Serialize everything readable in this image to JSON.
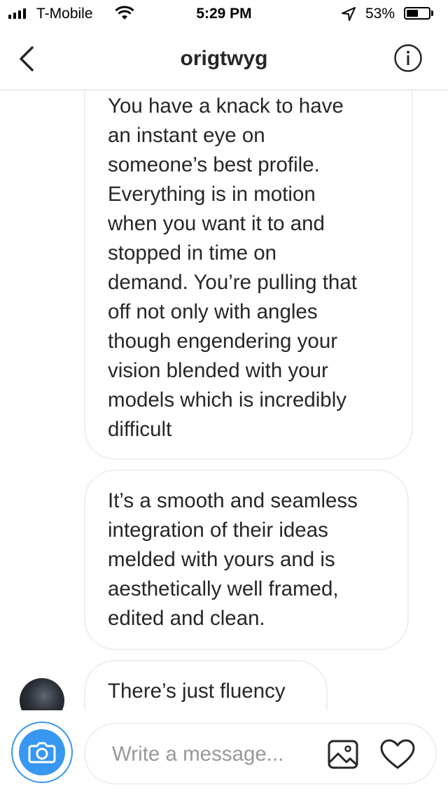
{
  "status_bar": {
    "carrier": "T-Mobile",
    "time": "5:29 PM",
    "battery_percent": "53%",
    "battery_level": 0.53,
    "icons": [
      "signal-icon",
      "wifi-icon",
      "location-arrow-icon",
      "battery-icon"
    ]
  },
  "header": {
    "title": "origtwyg",
    "back_icon": "chevron-left-icon",
    "info_icon": "info-icon"
  },
  "messages": [
    {
      "text": "You have a knack to have\nan instant eye on\nsomeone’s best profile.\nEverything is in motion\nwhen you want it to and\nstopped in time on\ndemand. You’re pulling that\noff not only with angles\nthough engendering your\nvision blended with your\nmodels which is incredibly\ndifficult"
    },
    {
      "text": "It’s a smooth and seamless\nintegration of their ideas\nmelded with yours and is\naesthetically well framed,\nedited and clean."
    },
    {
      "text": "There’s just fluency"
    }
  ],
  "composer": {
    "placeholder": "Write a message...",
    "camera_icon": "camera-icon",
    "gallery_icon": "gallery-icon",
    "like_icon": "heart-icon"
  },
  "colors": {
    "accent": "#3897f0",
    "bubble_border": "#efefef",
    "text": "#262626",
    "placeholder": "#999999",
    "divider": "#dbdbdb"
  }
}
